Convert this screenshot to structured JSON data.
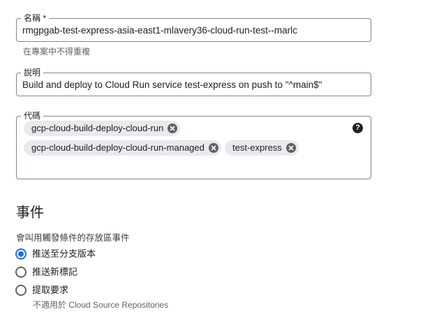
{
  "form": {
    "name": {
      "label": "名稱 *",
      "value": "rmgpgab-test-express-asia-east1-mlavery36-cloud-run-test--marlc",
      "hint": "在專案中不得重複"
    },
    "description": {
      "label": "說明",
      "value": "Build and deploy to Cloud Run service test-express on push to \"^main$\""
    },
    "tags": {
      "label": "代碼",
      "help_icon": "help-icon",
      "chips": [
        "gcp-cloud-build-deploy-cloud-run",
        "gcp-cloud-build-deploy-cloud-run-managed",
        "test-express"
      ]
    }
  },
  "event": {
    "title": "事件",
    "description": "會叫用觸發條件的存放區事件",
    "options": [
      {
        "label": "推送至分支版本",
        "selected": true
      },
      {
        "label": "推送新標記",
        "selected": false
      },
      {
        "label": "提取要求",
        "selected": false,
        "sublabel": "不適用於 Cloud Source Repositories"
      }
    ]
  },
  "colors": {
    "accent": "#1a73e8",
    "border": "#80868b",
    "chip_bg": "#e8eaed"
  }
}
